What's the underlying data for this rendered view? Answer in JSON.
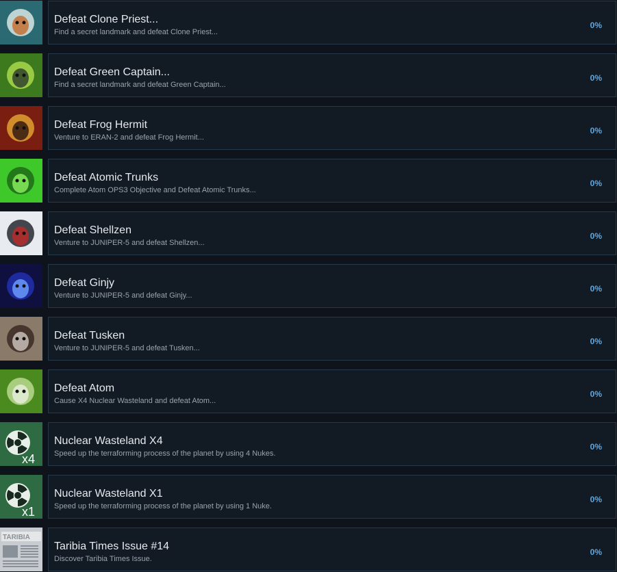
{
  "achievements": [
    {
      "title": "Defeat Clone Priest...",
      "description": "Find a secret landmark and defeat Clone Priest...",
      "progress": "0%",
      "icon": "clone-priest-icon",
      "colors": [
        "#2b6a72",
        "#d8e6e4",
        "#c46a2c"
      ]
    },
    {
      "title": "Defeat Green Captain...",
      "description": "Find a secret landmark and defeat Green Captain...",
      "progress": "0%",
      "icon": "green-captain-icon",
      "colors": [
        "#3d7a1e",
        "#a8d84a",
        "#2a3a2a"
      ]
    },
    {
      "title": "Defeat Frog Hermit",
      "description": "Venture to ERAN-2 and defeat Frog Hermit...",
      "progress": "0%",
      "icon": "frog-hermit-icon",
      "colors": [
        "#7a1e12",
        "#e0a030",
        "#2a1410"
      ]
    },
    {
      "title": "Defeat Atomic Trunks",
      "description": "Complete Atom OPS3 Objective and Defeat Atomic Trunks...",
      "progress": "0%",
      "icon": "atomic-trunks-icon",
      "colors": [
        "#3ec82a",
        "#1f6a18",
        "#8cf060"
      ]
    },
    {
      "title": "Defeat Shellzen",
      "description": "Venture to JUNIPER-5 and defeat Shellzen...",
      "progress": "0%",
      "icon": "shellzen-icon",
      "colors": [
        "#e8ecf0",
        "#262a30",
        "#c02828"
      ]
    },
    {
      "title": "Defeat Ginjy",
      "description": "Venture to JUNIPER-5 and defeat Ginjy...",
      "progress": "0%",
      "icon": "ginjy-icon",
      "colors": [
        "#101040",
        "#2030b0",
        "#70a0ff"
      ]
    },
    {
      "title": "Defeat Tusken",
      "description": "Venture to JUNIPER-5 and defeat Tusken...",
      "progress": "0%",
      "icon": "tusken-icon",
      "colors": [
        "#8a7a6a",
        "#3a2a22",
        "#d0c8c0"
      ]
    },
    {
      "title": "Defeat Atom",
      "description": "Cause X4 Nuclear Wasteland and defeat Atom...",
      "progress": "0%",
      "icon": "atom-icon",
      "colors": [
        "#4a8a1e",
        "#b8d890",
        "#e8f0e0"
      ]
    },
    {
      "title": "Nuclear Wasteland X4",
      "description": "Speed up the terraforming process of the planet by using 4 Nukes.",
      "progress": "0%",
      "icon": "nuke-x4-icon",
      "badge": "x4",
      "colors": [
        "#2e6a42",
        "#e8eee8",
        "#182a20"
      ]
    },
    {
      "title": "Nuclear Wasteland X1",
      "description": "Speed up the terraforming process of the planet by using 1 Nuke.",
      "progress": "0%",
      "icon": "nuke-x1-icon",
      "badge": "x1",
      "colors": [
        "#2e6a42",
        "#e8eee8",
        "#182a20"
      ]
    },
    {
      "title": "Taribia Times Issue #14",
      "description": "Discover Taribia Times Issue.",
      "progress": "0%",
      "icon": "newspaper-icon",
      "badge": "TARIBIA",
      "colors": [
        "#c8ccd0",
        "#8a9098",
        "#e4e6e8"
      ]
    }
  ]
}
